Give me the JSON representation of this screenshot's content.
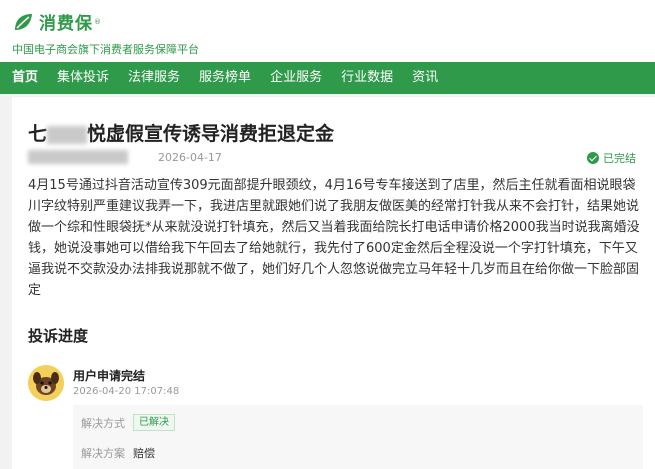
{
  "header": {
    "logo_text": "消费保",
    "logo_reg": "®",
    "slogan": "中国电子商会旗下消费者服务保障平台"
  },
  "nav": [
    {
      "label": "首页",
      "active": true
    },
    {
      "label": "集体投诉"
    },
    {
      "label": "法律服务"
    },
    {
      "label": "服务榜单"
    },
    {
      "label": "企业服务"
    },
    {
      "label": "行业数据"
    },
    {
      "label": "资讯"
    }
  ],
  "complaint": {
    "title_prefix": "七",
    "title_suffix": "悦虚假宣传诱导消费拒退定金",
    "date": "2026-04-17",
    "status": "已完结",
    "body": "4月15号通过抖音活动宣传309元面部提升眼颈纹，4月16号专车接送到了店里，然后主任就看面相说眼袋川字纹特别严重建议我弄一下，我进店里就跟她们说了我朋友做医美的经常打针我从来不会打针，结果她说做一个综和性眼袋抚*从来就没说打针填充，然后又当着我面给院长打电话申请价格2000我当时说我离婚没钱，她说没事她可以借给我下午回去了给她就行，我先付了600定金然后全程没说一个字打针填充，下午又逼我说不交款没办法排我说那就不做了，她们好几个人忽悠说做完立马年轻十几岁而且在给你做一下脸部固定"
  },
  "progress": {
    "section_title": "投诉进度",
    "steps": [
      {
        "title": "用户申请完结",
        "time": "2026-04-20 17:07:48",
        "method_label": "解决方式",
        "method_value": "已解决",
        "plan_label": "解决方案",
        "plan_value": "赔偿"
      }
    ]
  },
  "colors": {
    "brand_green": "#2f9a4a",
    "background": "#f2f2f2"
  },
  "icons": {
    "status": "check-circle-icon",
    "avatar": "dog-avatar-icon",
    "logo": "leaf-logo-icon"
  }
}
